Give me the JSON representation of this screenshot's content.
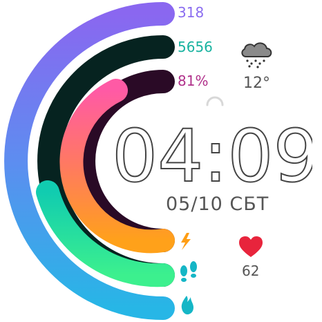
{
  "stats": {
    "calories": {
      "value": "318",
      "color": "#8a6cf0"
    },
    "steps": {
      "value": "5656",
      "color": "#19b3a0"
    },
    "battery": {
      "value": "81%",
      "color": "#b0308a"
    }
  },
  "weather": {
    "temperature": "12°",
    "icon": "cloud-snow-icon"
  },
  "time": {
    "display": "04:09"
  },
  "date": {
    "display": "05/10 СБТ"
  },
  "heart_rate": {
    "value": "62",
    "icon": "heart-icon",
    "color": "#e8243c"
  },
  "rings": {
    "calories": {
      "level": 1.0,
      "color_start": "#8a67f0",
      "color_end": "#27b6e6",
      "icon": "flame-icon"
    },
    "steps": {
      "level": 0.45,
      "color_start": "#11ccb0",
      "color_end": "#3cf08e",
      "track_color": "#062320",
      "icon": "footprints-icon"
    },
    "battery": {
      "level": 0.81,
      "color_start": "#ff5aa5",
      "color_end": "#ffa11a",
      "track_color": "#2a0a26",
      "icon": "lightning-icon"
    }
  },
  "accent_icon_color": "#15b6c6",
  "battery_icon_color": "#ff9e14"
}
